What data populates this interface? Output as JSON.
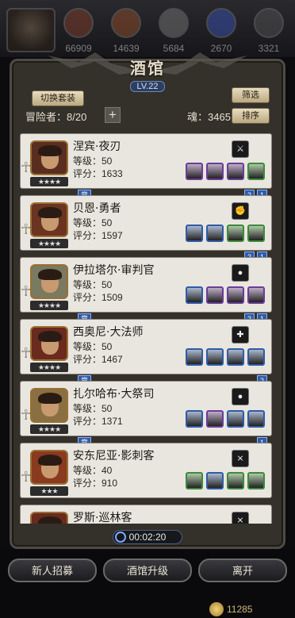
{
  "resources": [
    {
      "value": "66909",
      "color": "#7a3b2a"
    },
    {
      "value": "14639",
      "color": "#8a4a2a"
    },
    {
      "value": "5684",
      "color": "#707070"
    },
    {
      "value": "2670",
      "color": "#3a4ea8"
    },
    {
      "value": "3321",
      "color": "#505050"
    }
  ],
  "header": {
    "title": "酒馆",
    "level": "LV.22"
  },
  "controls": {
    "switch_set": "切换套装",
    "filter": "筛选",
    "sort": "排序",
    "adventurers": "冒险者：8/20",
    "plus": "+",
    "soul": "魂：3465"
  },
  "heroes": [
    {
      "name": "涅宾·夜刃",
      "level": "等级：50",
      "score": "评分：1633",
      "stars": "★★★★",
      "role": "⚔",
      "badges": [
        "2",
        "1"
      ],
      "tag": "竞",
      "equips": [
        "#6a3c9a",
        "#6a3c9a",
        "#6a3c9a",
        "#3c8a3c"
      ],
      "avatar_bg": "#5a2e1e"
    },
    {
      "name": "贝恩·勇者",
      "level": "等级：50",
      "score": "评分：1597",
      "stars": "★★★★",
      "role": "✊",
      "badges": [
        "2",
        "1"
      ],
      "tag": "",
      "equips": [
        "#2f5ba8",
        "#2f5ba8",
        "#3c8a3c",
        "#3c8a3c"
      ],
      "avatar_bg": "#6a3420"
    },
    {
      "name": "伊拉塔尔·审判官",
      "level": "等级：50",
      "score": "评分：1509",
      "stars": "★★★★",
      "role": "●",
      "badges": [
        "2",
        "1"
      ],
      "tag": "竞",
      "equips": [
        "#2f5ba8",
        "#6a3c9a",
        "#6a3c9a",
        "#6a3c9a"
      ],
      "avatar_bg": "#7a7a60"
    },
    {
      "name": "西奥尼·大法师",
      "level": "等级：50",
      "score": "评分：1467",
      "stars": "★★★★",
      "role": "✚",
      "badges": [
        "2"
      ],
      "tag": "竞",
      "equips": [
        "#2f5ba8",
        "#2f5ba8",
        "#2f5ba8",
        "#2f5ba8"
      ],
      "avatar_bg": "#6a2a1e"
    },
    {
      "name": "扎尔哈布·大祭司",
      "level": "等级：50",
      "score": "评分：1371",
      "stars": "★★★★",
      "role": "●",
      "badges": [
        "1"
      ],
      "tag": "竞",
      "equips": [
        "#2f5ba8",
        "#6a3c9a",
        "#2f5ba8",
        "#2f5ba8"
      ],
      "avatar_bg": "#8a7040"
    },
    {
      "name": "安东尼亚·影刺客",
      "level": "等级：40",
      "score": "评分：910",
      "stars": "★★★",
      "role": "⨯",
      "badges": [],
      "tag": "",
      "equips": [
        "#3c8a3c",
        "#2f5ba8",
        "#3c8a3c",
        "#3c8a3c"
      ],
      "avatar_bg": "#8a3a1e"
    },
    {
      "name": "罗斯·巡林客",
      "level": "",
      "score": "",
      "stars": "",
      "role": "⨯",
      "badges": [],
      "tag": "",
      "equips": [],
      "avatar_bg": "#6a2a1e"
    }
  ],
  "timer": "00:02:20",
  "buttons": {
    "recruit": "新人招募",
    "upgrade": "酒馆升级",
    "leave": "离开"
  },
  "gold": "11285"
}
